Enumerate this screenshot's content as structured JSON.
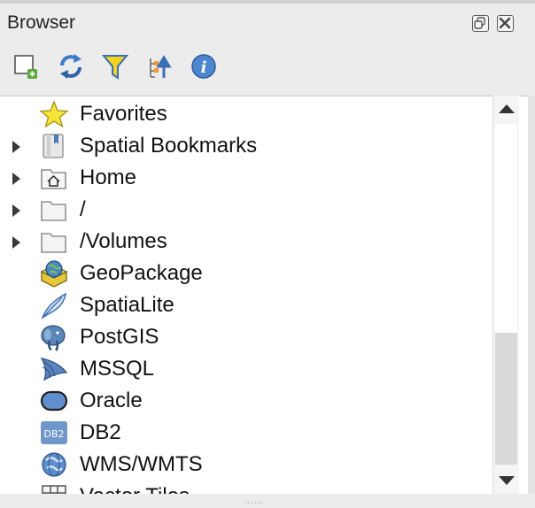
{
  "panel": {
    "title": "Browser"
  },
  "window_buttons": [
    {
      "name": "float-button"
    },
    {
      "name": "close-button"
    }
  ],
  "toolbar": [
    {
      "icon": "add-layer-icon"
    },
    {
      "icon": "refresh-icon"
    },
    {
      "icon": "filter-icon"
    },
    {
      "icon": "collapse-all-icon"
    },
    {
      "icon": "info-icon"
    }
  ],
  "tree": {
    "items": [
      {
        "label": "Favorites",
        "icon": "star-icon",
        "expandable": false
      },
      {
        "label": "Spatial Bookmarks",
        "icon": "bookmark-icon",
        "expandable": true
      },
      {
        "label": "Home",
        "icon": "home-folder-icon",
        "expandable": true
      },
      {
        "label": "/",
        "icon": "folder-icon",
        "expandable": true
      },
      {
        "label": "/Volumes",
        "icon": "folder-icon",
        "expandable": true
      },
      {
        "label": "GeoPackage",
        "icon": "geopackage-icon",
        "expandable": false
      },
      {
        "label": "SpatiaLite",
        "icon": "feather-icon",
        "expandable": false
      },
      {
        "label": "PostGIS",
        "icon": "elephant-icon",
        "expandable": false
      },
      {
        "label": "MSSQL",
        "icon": "sail-icon",
        "expandable": false
      },
      {
        "label": "Oracle",
        "icon": "oracle-icon",
        "expandable": false
      },
      {
        "label": "DB2",
        "icon": "db2-icon",
        "expandable": false
      },
      {
        "label": "WMS/WMTS",
        "icon": "globe-icon",
        "expandable": false
      },
      {
        "label": "Vector Tiles",
        "icon": "grid-icon",
        "expandable": false
      }
    ],
    "db2_badge": "DB2"
  },
  "colors": {
    "folder_outline": "#7a7a7a",
    "icon_blue": "#4a7ab8",
    "star_yellow": "#f7e43a"
  }
}
